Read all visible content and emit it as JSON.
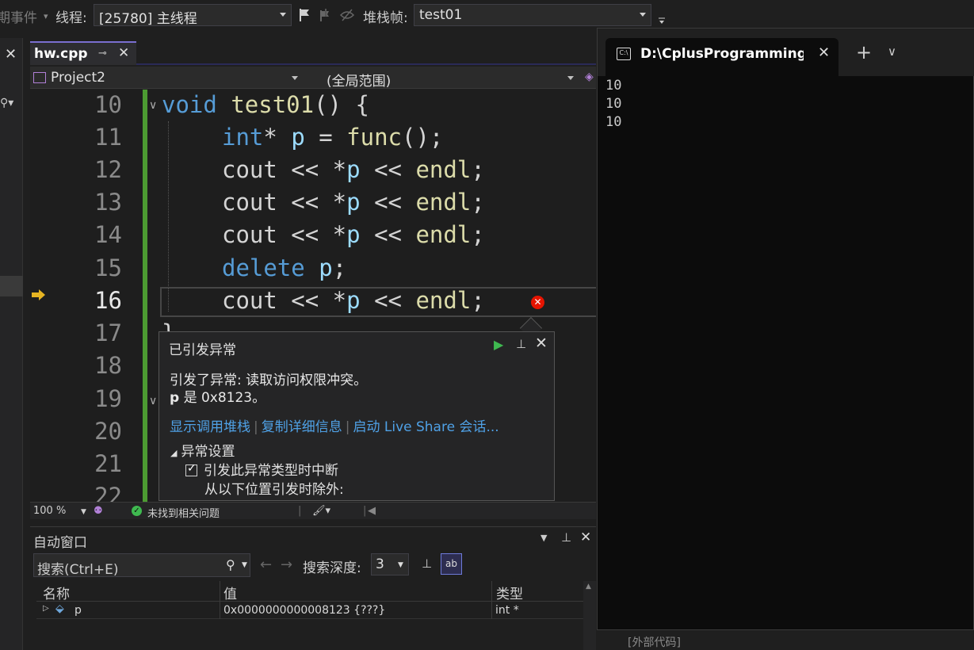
{
  "toolbar": {
    "events_label": "期事件",
    "thread_label": "线程:",
    "thread_value": "[25780] 主线程",
    "stackframe_label": "堆栈帧:",
    "stackframe_value": "test01"
  },
  "editor_tab": {
    "filename": "hw.cpp"
  },
  "navbar": {
    "project": "Project2",
    "scope": "(全局范围)"
  },
  "code": {
    "lines": [
      {
        "num": "10",
        "text": "void test01() {"
      },
      {
        "num": "11",
        "text": "int* p = func();"
      },
      {
        "num": "12",
        "text": "cout << *p << endl;"
      },
      {
        "num": "13",
        "text": "cout << *p << endl;"
      },
      {
        "num": "14",
        "text": "cout << *p << endl;"
      },
      {
        "num": "15",
        "text": "delete p;"
      },
      {
        "num": "16",
        "text": "cout << *p << endl;"
      },
      {
        "num": "17",
        "text": "}"
      },
      {
        "num": "18",
        "text": ""
      },
      {
        "num": "19",
        "text": ""
      },
      {
        "num": "20",
        "text": ""
      },
      {
        "num": "21",
        "text": ""
      },
      {
        "num": "22",
        "text": ""
      }
    ],
    "current_line": "16"
  },
  "exception_popup": {
    "title": "已引发异常",
    "message_line1": "引发了异常: 读取访问权限冲突。",
    "message_var": "p",
    "message_line2_rest": " 是 0x8123。",
    "link_stack": "显示调用堆栈",
    "link_copy": "复制详细信息",
    "link_liveshare": "启动 Live Share 会话...",
    "section": "异常设置",
    "checkbox_label": "引发此异常类型时中断",
    "except_label": "从以下位置引发时除外:"
  },
  "statusbar": {
    "zoom": "100 %",
    "issues": "未找到相关问题"
  },
  "autos": {
    "title": "自动窗口",
    "search_placeholder": "搜索(Ctrl+E)",
    "depth_label": "搜索深度:",
    "depth_value": "3",
    "columns": [
      "名称",
      "值",
      "类型"
    ],
    "rows": [
      {
        "name": "p",
        "value": "0x0000000000008123 {???}",
        "type": "int *"
      }
    ],
    "external_code": "[外部代码]"
  },
  "terminal": {
    "tab_title": "D:\\CplusProgramming\\P",
    "output": [
      "10",
      "10",
      "10"
    ]
  }
}
